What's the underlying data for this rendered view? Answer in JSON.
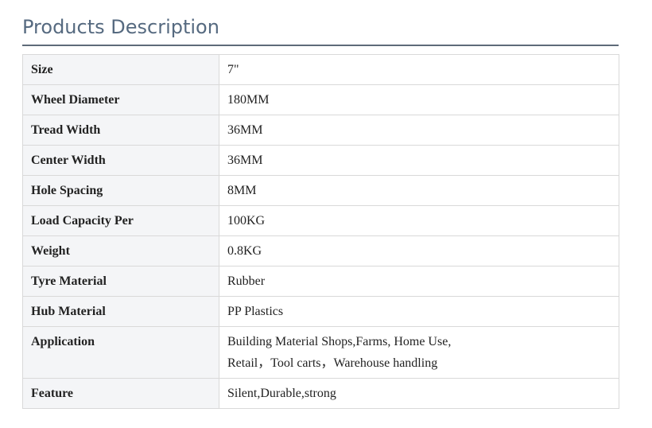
{
  "section": {
    "title": "Products Description"
  },
  "spec_table": {
    "rows": [
      {
        "label": "Size",
        "value": "7\""
      },
      {
        "label": "Wheel Diameter",
        "value": "180MM"
      },
      {
        "label": "Tread Width",
        "value": "36MM"
      },
      {
        "label": "Center Width",
        "value": "36MM"
      },
      {
        "label": "Hole Spacing",
        "value": "8MM"
      },
      {
        "label": "Load Capacity Per",
        "value": "100KG"
      },
      {
        "label": "Weight",
        "value": "0.8KG"
      },
      {
        "label": "Tyre Material",
        "value": "Rubber"
      },
      {
        "label": "Hub Material",
        "value": "PP Plastics"
      },
      {
        "label": "Application",
        "value_lines": [
          "Building Material Shops,Farms, Home Use,",
          "Retail，Tool carts，Warehouse handling"
        ]
      },
      {
        "label": "Feature",
        "value": "Silent,Durable,strong"
      }
    ]
  },
  "colors": {
    "title": "#566a80",
    "rule": "#5e6b79",
    "label_bg": "#f4f5f7",
    "border": "#d9d9d9",
    "text": "#222222"
  }
}
